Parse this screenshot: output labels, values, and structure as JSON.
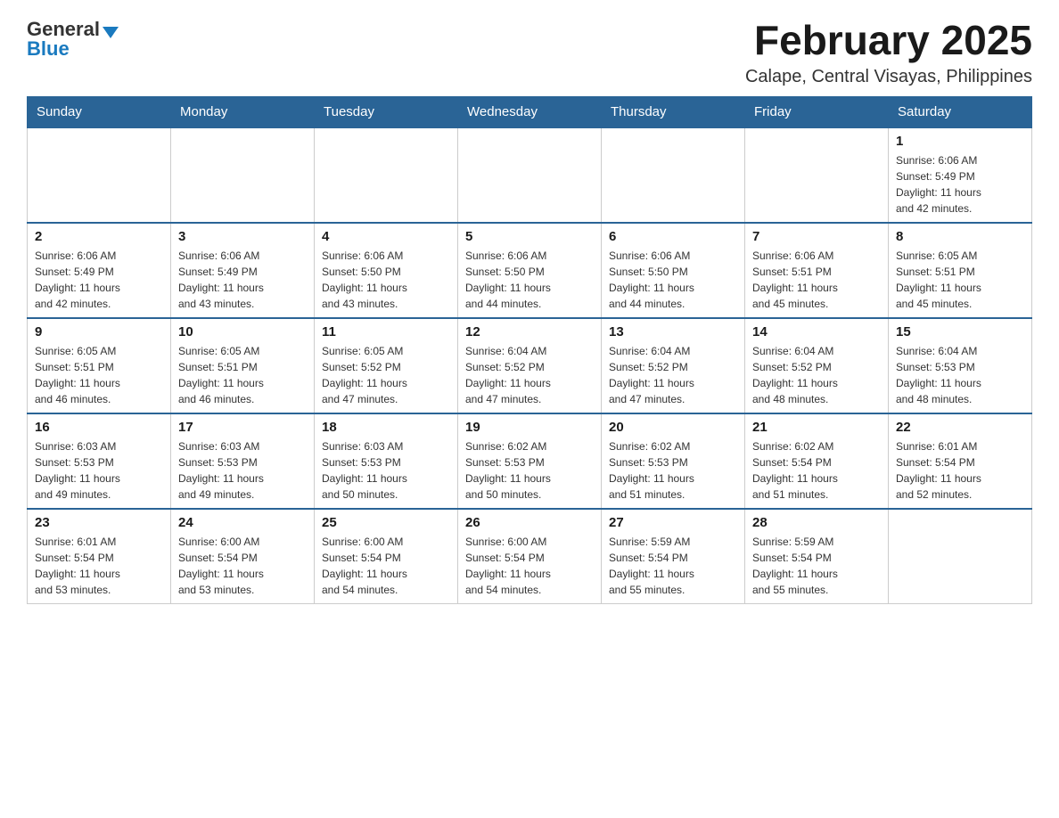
{
  "header": {
    "logo": {
      "general": "General",
      "blue": "Blue",
      "arrow": "▶"
    },
    "title": "February 2025",
    "subtitle": "Calape, Central Visayas, Philippines"
  },
  "days_of_week": [
    "Sunday",
    "Monday",
    "Tuesday",
    "Wednesday",
    "Thursday",
    "Friday",
    "Saturday"
  ],
  "weeks": [
    {
      "days": [
        {
          "num": "",
          "info": ""
        },
        {
          "num": "",
          "info": ""
        },
        {
          "num": "",
          "info": ""
        },
        {
          "num": "",
          "info": ""
        },
        {
          "num": "",
          "info": ""
        },
        {
          "num": "",
          "info": ""
        },
        {
          "num": "1",
          "info": "Sunrise: 6:06 AM\nSunset: 5:49 PM\nDaylight: 11 hours\nand 42 minutes."
        }
      ]
    },
    {
      "days": [
        {
          "num": "2",
          "info": "Sunrise: 6:06 AM\nSunset: 5:49 PM\nDaylight: 11 hours\nand 42 minutes."
        },
        {
          "num": "3",
          "info": "Sunrise: 6:06 AM\nSunset: 5:49 PM\nDaylight: 11 hours\nand 43 minutes."
        },
        {
          "num": "4",
          "info": "Sunrise: 6:06 AM\nSunset: 5:50 PM\nDaylight: 11 hours\nand 43 minutes."
        },
        {
          "num": "5",
          "info": "Sunrise: 6:06 AM\nSunset: 5:50 PM\nDaylight: 11 hours\nand 44 minutes."
        },
        {
          "num": "6",
          "info": "Sunrise: 6:06 AM\nSunset: 5:50 PM\nDaylight: 11 hours\nand 44 minutes."
        },
        {
          "num": "7",
          "info": "Sunrise: 6:06 AM\nSunset: 5:51 PM\nDaylight: 11 hours\nand 45 minutes."
        },
        {
          "num": "8",
          "info": "Sunrise: 6:05 AM\nSunset: 5:51 PM\nDaylight: 11 hours\nand 45 minutes."
        }
      ]
    },
    {
      "days": [
        {
          "num": "9",
          "info": "Sunrise: 6:05 AM\nSunset: 5:51 PM\nDaylight: 11 hours\nand 46 minutes."
        },
        {
          "num": "10",
          "info": "Sunrise: 6:05 AM\nSunset: 5:51 PM\nDaylight: 11 hours\nand 46 minutes."
        },
        {
          "num": "11",
          "info": "Sunrise: 6:05 AM\nSunset: 5:52 PM\nDaylight: 11 hours\nand 47 minutes."
        },
        {
          "num": "12",
          "info": "Sunrise: 6:04 AM\nSunset: 5:52 PM\nDaylight: 11 hours\nand 47 minutes."
        },
        {
          "num": "13",
          "info": "Sunrise: 6:04 AM\nSunset: 5:52 PM\nDaylight: 11 hours\nand 47 minutes."
        },
        {
          "num": "14",
          "info": "Sunrise: 6:04 AM\nSunset: 5:52 PM\nDaylight: 11 hours\nand 48 minutes."
        },
        {
          "num": "15",
          "info": "Sunrise: 6:04 AM\nSunset: 5:53 PM\nDaylight: 11 hours\nand 48 minutes."
        }
      ]
    },
    {
      "days": [
        {
          "num": "16",
          "info": "Sunrise: 6:03 AM\nSunset: 5:53 PM\nDaylight: 11 hours\nand 49 minutes."
        },
        {
          "num": "17",
          "info": "Sunrise: 6:03 AM\nSunset: 5:53 PM\nDaylight: 11 hours\nand 49 minutes."
        },
        {
          "num": "18",
          "info": "Sunrise: 6:03 AM\nSunset: 5:53 PM\nDaylight: 11 hours\nand 50 minutes."
        },
        {
          "num": "19",
          "info": "Sunrise: 6:02 AM\nSunset: 5:53 PM\nDaylight: 11 hours\nand 50 minutes."
        },
        {
          "num": "20",
          "info": "Sunrise: 6:02 AM\nSunset: 5:53 PM\nDaylight: 11 hours\nand 51 minutes."
        },
        {
          "num": "21",
          "info": "Sunrise: 6:02 AM\nSunset: 5:54 PM\nDaylight: 11 hours\nand 51 minutes."
        },
        {
          "num": "22",
          "info": "Sunrise: 6:01 AM\nSunset: 5:54 PM\nDaylight: 11 hours\nand 52 minutes."
        }
      ]
    },
    {
      "days": [
        {
          "num": "23",
          "info": "Sunrise: 6:01 AM\nSunset: 5:54 PM\nDaylight: 11 hours\nand 53 minutes."
        },
        {
          "num": "24",
          "info": "Sunrise: 6:00 AM\nSunset: 5:54 PM\nDaylight: 11 hours\nand 53 minutes."
        },
        {
          "num": "25",
          "info": "Sunrise: 6:00 AM\nSunset: 5:54 PM\nDaylight: 11 hours\nand 54 minutes."
        },
        {
          "num": "26",
          "info": "Sunrise: 6:00 AM\nSunset: 5:54 PM\nDaylight: 11 hours\nand 54 minutes."
        },
        {
          "num": "27",
          "info": "Sunrise: 5:59 AM\nSunset: 5:54 PM\nDaylight: 11 hours\nand 55 minutes."
        },
        {
          "num": "28",
          "info": "Sunrise: 5:59 AM\nSunset: 5:54 PM\nDaylight: 11 hours\nand 55 minutes."
        },
        {
          "num": "",
          "info": ""
        }
      ]
    }
  ]
}
